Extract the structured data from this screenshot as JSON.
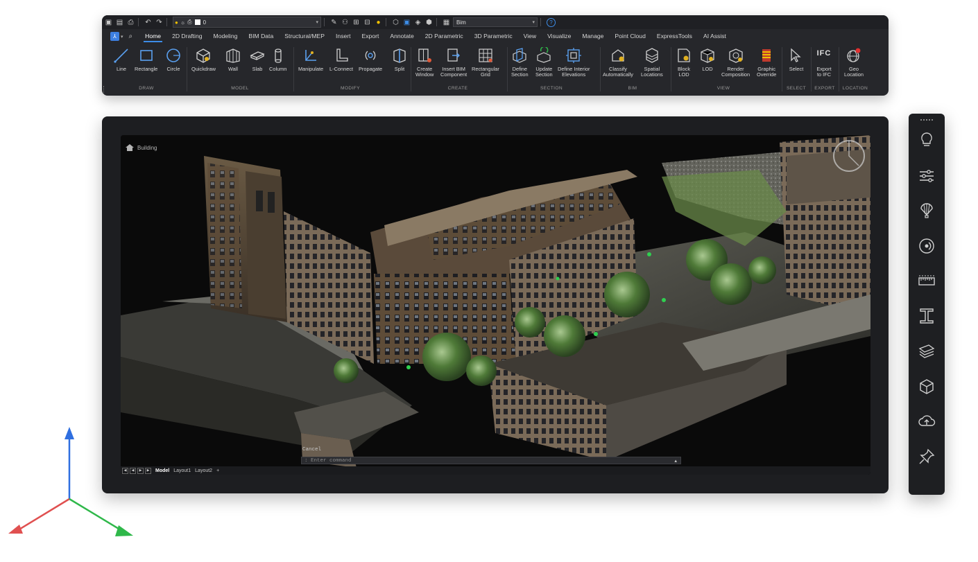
{
  "quick_access": {
    "layer_name": "0",
    "workspace": "Bim"
  },
  "ribbon_tabs": [
    "Home",
    "2D Drafting",
    "Modeling",
    "BIM Data",
    "Structural/MEP",
    "Insert",
    "Export",
    "Annotate",
    "2D Parametric",
    "3D Parametric",
    "View",
    "Visualize",
    "Manage",
    "Point Cloud",
    "ExpressTools",
    "AI Assist"
  ],
  "tools": {
    "line": "Line",
    "rectangle": "Rectangle",
    "circle": "Circle",
    "quickdraw": "Quickdraw",
    "wall": "Wall",
    "slab": "Slab",
    "column": "Column",
    "manipulate": "Manipulate",
    "lconnect": "L-Connect",
    "propagate": "Propagate",
    "split": "Split",
    "create_window_1": "Create",
    "create_window_2": "Window",
    "insert_bim_1": "Insert BIM",
    "insert_bim_2": "Component",
    "rect_grid_1": "Rectangular",
    "rect_grid_2": "Grid",
    "define_section_1": "Define",
    "define_section_2": "Section",
    "update_section_1": "Update",
    "update_section_2": "Section",
    "define_interior_1": "Define Interior",
    "define_interior_2": "Elevations",
    "classify_1": "Classify",
    "classify_2": "Automatically",
    "spatial_1": "Spatial",
    "spatial_2": "Locations",
    "block_lod_1": "Block",
    "block_lod_2": "LOD",
    "lod": "LOD",
    "render_comp_1": "Render",
    "render_comp_2": "Composition",
    "graphic_ov_1": "Graphic",
    "graphic_ov_2": "Override",
    "select": "Select",
    "export_ifc_1": "Export",
    "export_ifc_2": "to IFC",
    "geo_loc_1": "Geo",
    "geo_loc_2": "Location",
    "ifc_text": "IFC"
  },
  "groups": {
    "draw": "DRAW",
    "model": "MODEL",
    "modify": "MODIFY",
    "create": "CREATE",
    "section": "SECTION",
    "bim": "BIM",
    "view": "VIEW",
    "select": "SELECT",
    "export": "EXPORT",
    "location": "LOCATION"
  },
  "viewport": {
    "breadcrumb": "Building",
    "command_history": "Cancel",
    "command_placeholder": ": Enter command",
    "layout_tabs": [
      "Model",
      "Layout1",
      "Layout2",
      "+"
    ]
  },
  "right_toolbar": [
    "lightbulb-icon",
    "sliders-icon",
    "balloon-icon",
    "propagate-icon",
    "ruler-icon",
    "i-beam-icon",
    "layers-icon",
    "cube-icon",
    "cloud-upload-icon",
    "pin-icon"
  ],
  "colors": {
    "accent": "#3d8de8",
    "axis_x": "#e05050",
    "axis_y": "#2f6fe0",
    "axis_z": "#2fb84a"
  }
}
